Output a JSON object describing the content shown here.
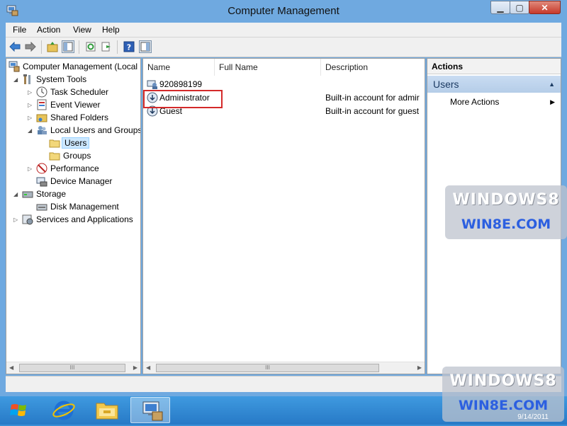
{
  "window": {
    "title": "Computer Management"
  },
  "menu": [
    "File",
    "Action",
    "View",
    "Help"
  ],
  "tree": {
    "root": "Computer Management (Local",
    "system_tools": "System Tools",
    "task_scheduler": "Task Scheduler",
    "event_viewer": "Event Viewer",
    "shared_folders": "Shared Folders",
    "local_users_groups": "Local Users and Groups",
    "users": "Users",
    "groups": "Groups",
    "performance": "Performance",
    "device_manager": "Device Manager",
    "storage": "Storage",
    "disk_management": "Disk Management",
    "services_apps": "Services and Applications"
  },
  "list": {
    "columns": [
      "Name",
      "Full Name",
      "Description"
    ],
    "rows": [
      {
        "name": "920898199",
        "full_name": "",
        "description": ""
      },
      {
        "name": "Administrator",
        "full_name": "",
        "description": "Built-in account for admir"
      },
      {
        "name": "Guest",
        "full_name": "",
        "description": "Built-in account for guest"
      }
    ]
  },
  "actions": {
    "header": "Actions",
    "section": "Users",
    "more": "More Actions"
  },
  "scrollbar": {
    "thumb": "III"
  },
  "watermark": {
    "line1": "WINDOWS8",
    "line2": "WIN8E.COM"
  },
  "taskbar": {
    "date": "9/14/2011"
  },
  "colors": {
    "highlight": "#d42a2a",
    "title_bar": "#6fa9e0",
    "taskbar": "#2f86d2"
  }
}
